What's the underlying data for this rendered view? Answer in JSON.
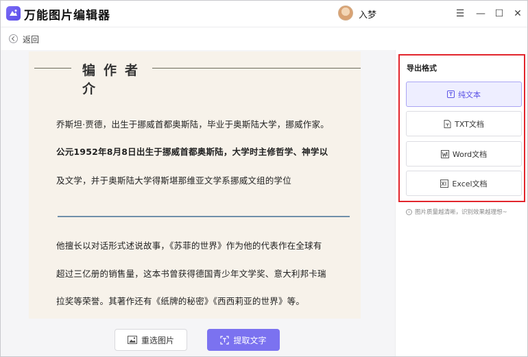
{
  "app": {
    "title": "万能图片编辑器",
    "user": "入梦"
  },
  "window_controls": {
    "menu": "☰",
    "minimize": "—",
    "maximize": "☐",
    "close": "✕"
  },
  "nav": {
    "back_label": "返回"
  },
  "document": {
    "heading": "作者介",
    "heading_partial_glyph": "犏",
    "lines": [
      "乔斯坦·贾德，出生于挪威首都奥斯陆，毕业于奥斯陆大学，挪威作家。",
      "公元1952年8月8日出生于挪威首都奥斯陆，大学时主修哲学、神学以",
      "及文学，并于奥斯陆大学得斯堪那维亚文学系挪威文组的学位",
      "他擅长以对话形式述说故事，《苏菲的世界》作为他的代表作在全球有",
      "超过三亿册的销售量，这本书曾获得德国青少年文学奖、意大利邦卡瑞",
      "拉奖等荣誉。其著作还有《纸牌的秘密》《西西莉亚的世界》等。"
    ]
  },
  "actions": {
    "reselect_label": "重选图片",
    "extract_label": "提取文字"
  },
  "export": {
    "title": "导出格式",
    "options": [
      {
        "label": "纯文本",
        "icon": "text-icon",
        "active": true
      },
      {
        "label": "TXT文档",
        "icon": "txt-file-icon",
        "active": false
      },
      {
        "label": "Word文档",
        "icon": "word-file-icon",
        "active": false
      },
      {
        "label": "Excel文档",
        "icon": "excel-file-icon",
        "active": false
      }
    ],
    "hint": "图片质量越清晰，识别效果越理想~"
  },
  "colors": {
    "accent": "#7b72f0",
    "highlight_border": "#e2242b"
  }
}
